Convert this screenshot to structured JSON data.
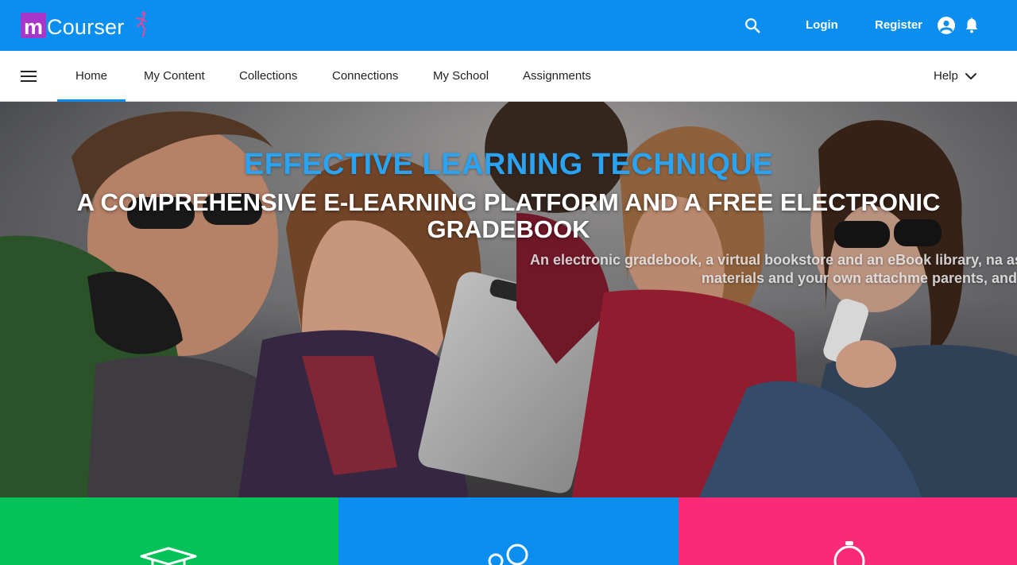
{
  "app": {
    "logo_letter": "m",
    "logo_wordmark": "Courser"
  },
  "topbar": {
    "search_icon": "search-icon",
    "login_label": "Login",
    "register_label": "Register",
    "account_icon": "account-circle-icon",
    "notifications_icon": "bell-icon"
  },
  "nav": {
    "menu_icon": "hamburger-menu-icon",
    "tabs": [
      {
        "label": "Home",
        "active": true
      },
      {
        "label": "My Content",
        "active": false
      },
      {
        "label": "Collections",
        "active": false
      },
      {
        "label": "Connections",
        "active": false
      },
      {
        "label": "My School",
        "active": false
      },
      {
        "label": "Assignments",
        "active": false
      }
    ],
    "help_label": "Help"
  },
  "hero": {
    "eyebrow": "EFFECTIVE LEARNING TECHNIQUE",
    "title": "A COMPREHENSIVE E-LEARNING PLATFORM AND A FREE ELECTRONIC GRADEBOOK",
    "description": "An electronic gradebook, a virtual bookstore and an eBook library, na assignments made from interactive materials and your own attachme parents, and many m"
  },
  "tiles": [
    {
      "icon": "graduation-cap-icon"
    },
    {
      "icon": "connections-circles-icon"
    },
    {
      "icon": "stopwatch-icon"
    }
  ],
  "colors": {
    "primary": "#0a8ff0",
    "tile_green": "#03c358",
    "tile_blue": "#0a8ff0",
    "tile_pink": "#fb2a76",
    "logo_purple": "#a637c9",
    "eyebrow_blue": "#2aa3f2"
  }
}
